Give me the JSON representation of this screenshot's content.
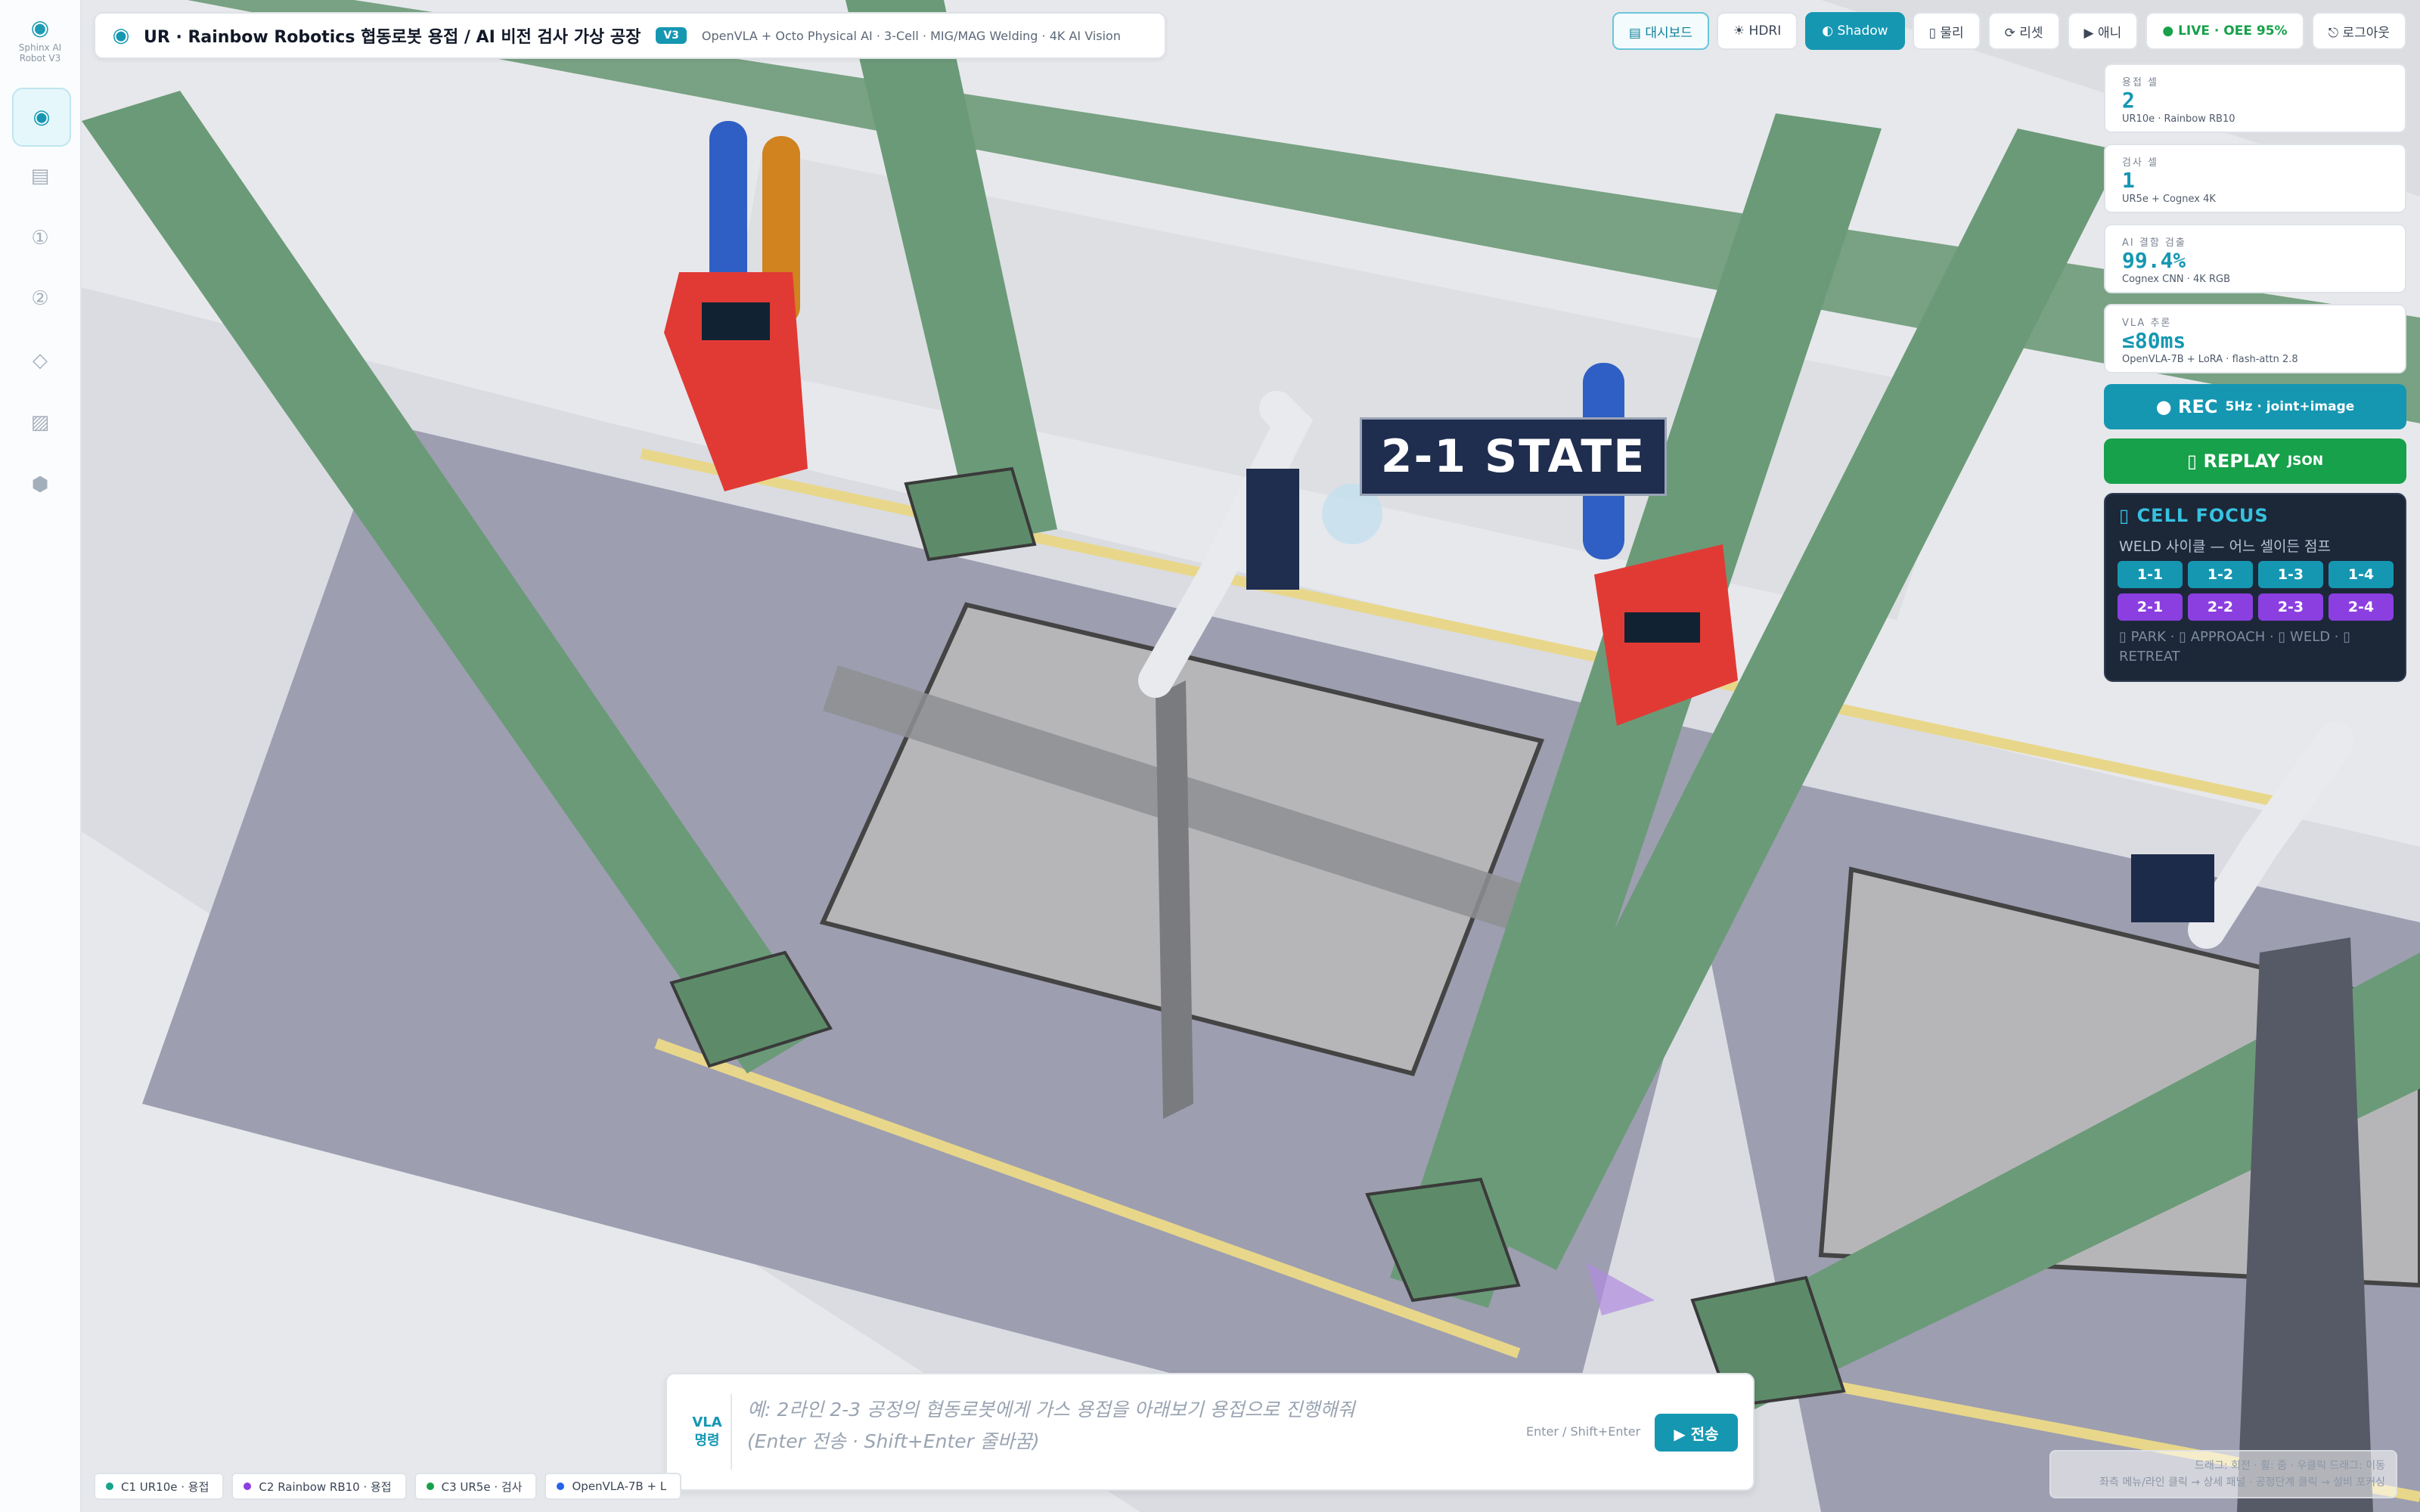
{
  "brand": {
    "name": "Sphinx AI Robot V3"
  },
  "header": {
    "title": "UR · Rainbow Robotics 협동로봇 용접 / AI 비전 검사 가상 공장",
    "version": "V3",
    "subtitle": "OpenVLA + Octo Physical AI · 3-Cell · MIG/MAG Welding · 4K AI Vision"
  },
  "toolbar": {
    "dashboard": "▤ 대시보드",
    "hdri": "☀ HDRI",
    "shadow": "◐ Shadow",
    "physics": "▯ 물리",
    "reset": "⟳ 리셋",
    "anim": "▶ 애니",
    "live": "● LIVE · OEE 95%",
    "logout": "⎋ 로그아웃"
  },
  "stats": [
    {
      "label": "용접 셀",
      "value": "2",
      "caption": "UR10e · Rainbow RB10"
    },
    {
      "label": "검사 셀",
      "value": "1",
      "caption": "UR5e + Cognex 4K"
    },
    {
      "label": "AI 결함 검출",
      "value": "99.4%",
      "caption": "Cognex CNN · 4K RGB"
    },
    {
      "label": "VLA 추론",
      "value": "≤80ms",
      "caption": "OpenVLA-7B + LoRA · flash-attn 2.8"
    }
  ],
  "rec": {
    "label": "● REC",
    "detail": "5Hz · joint+image"
  },
  "replay": {
    "label": "▯ REPLAY",
    "detail": "JSON"
  },
  "focus": {
    "title": "▯ CELL FOCUS",
    "subtitle": "WELD 사이클 — 어느 셀이든 점프",
    "cells": [
      "1-1",
      "1-2",
      "1-3",
      "1-4",
      "2-1",
      "2-2",
      "2-3",
      "2-4"
    ],
    "legend": "▯ PARK · ▯ APPROACH · ▯ WELD · ▯ RETREAT"
  },
  "scene": {
    "state_label": "2-1 STATE"
  },
  "command": {
    "tag": "VLA 명령",
    "placeholder": "예: 2라인 2-3 공정의 협동로봇에게 가스 용접을 아래보기 용접으로 진행해줘\n(Enter 전송 · Shift+Enter 줄바꿈)",
    "hint": "Enter / Shift+Enter",
    "send": "▶ 전송"
  },
  "chips": [
    {
      "label": "C1 UR10e · 용접",
      "color": "#17a58a"
    },
    {
      "label": "C2 Rainbow RB10 · 용접",
      "color": "#8b3fe0"
    },
    {
      "label": "C3 UR5e · 검사",
      "color": "#17a14a"
    },
    {
      "label": "OpenVLA-7B + L",
      "color": "#2563eb"
    }
  ],
  "help": {
    "line1": "드래그: 회전 · 휠: 줌 · 우클릭 드래그: 이동",
    "line2": "좌측 메뉴/라인 클릭 → 상세 패널 · 공정단계 클릭 → 설비 포커싱"
  },
  "icons": {
    "rail": [
      "target-icon",
      "grid-icon",
      "line1-icon",
      "line2-icon",
      "diamond-icon",
      "layers-icon",
      "hex-icon"
    ]
  },
  "colors": {
    "accent": "#1597b2",
    "success": "#17a14a",
    "purple": "#8b3fe0",
    "steel": "#6b9a78"
  }
}
